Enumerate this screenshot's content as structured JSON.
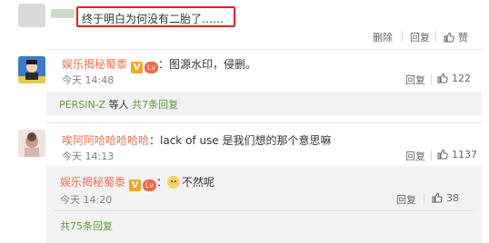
{
  "top": {
    "text": "终于明白为何没有二胎了……",
    "delete": "删除",
    "reply": "回复",
    "like": "赞"
  },
  "c1": {
    "name": "娱乐揭秘蜀黍",
    "text": "：图源水印，侵删。",
    "time": "今天 14:48",
    "reply": "回复",
    "likes": "122"
  },
  "sub1": {
    "name": "PERSIN-Z",
    "etc": " 等人",
    "count": "共7条回复"
  },
  "c2": {
    "name": "唉阿阿哈哈哈哈哈",
    "text": "：lack  of use 是我们想的那个意思嘛",
    "time": "今天 14:13",
    "reply": "回复",
    "likes": "1137"
  },
  "r1": {
    "name": "娱乐揭秘蜀黍",
    "text": "不然呢",
    "time": "今天 14:20",
    "reply": "回复",
    "likes": "38"
  },
  "more": {
    "label": "共75条回复"
  },
  "badges": {
    "v": "V",
    "lv": "Lv"
  },
  "colors": {
    "accent": "#eb7350",
    "highlight_border": "#e02020",
    "link_green": "#5a9e2f"
  }
}
